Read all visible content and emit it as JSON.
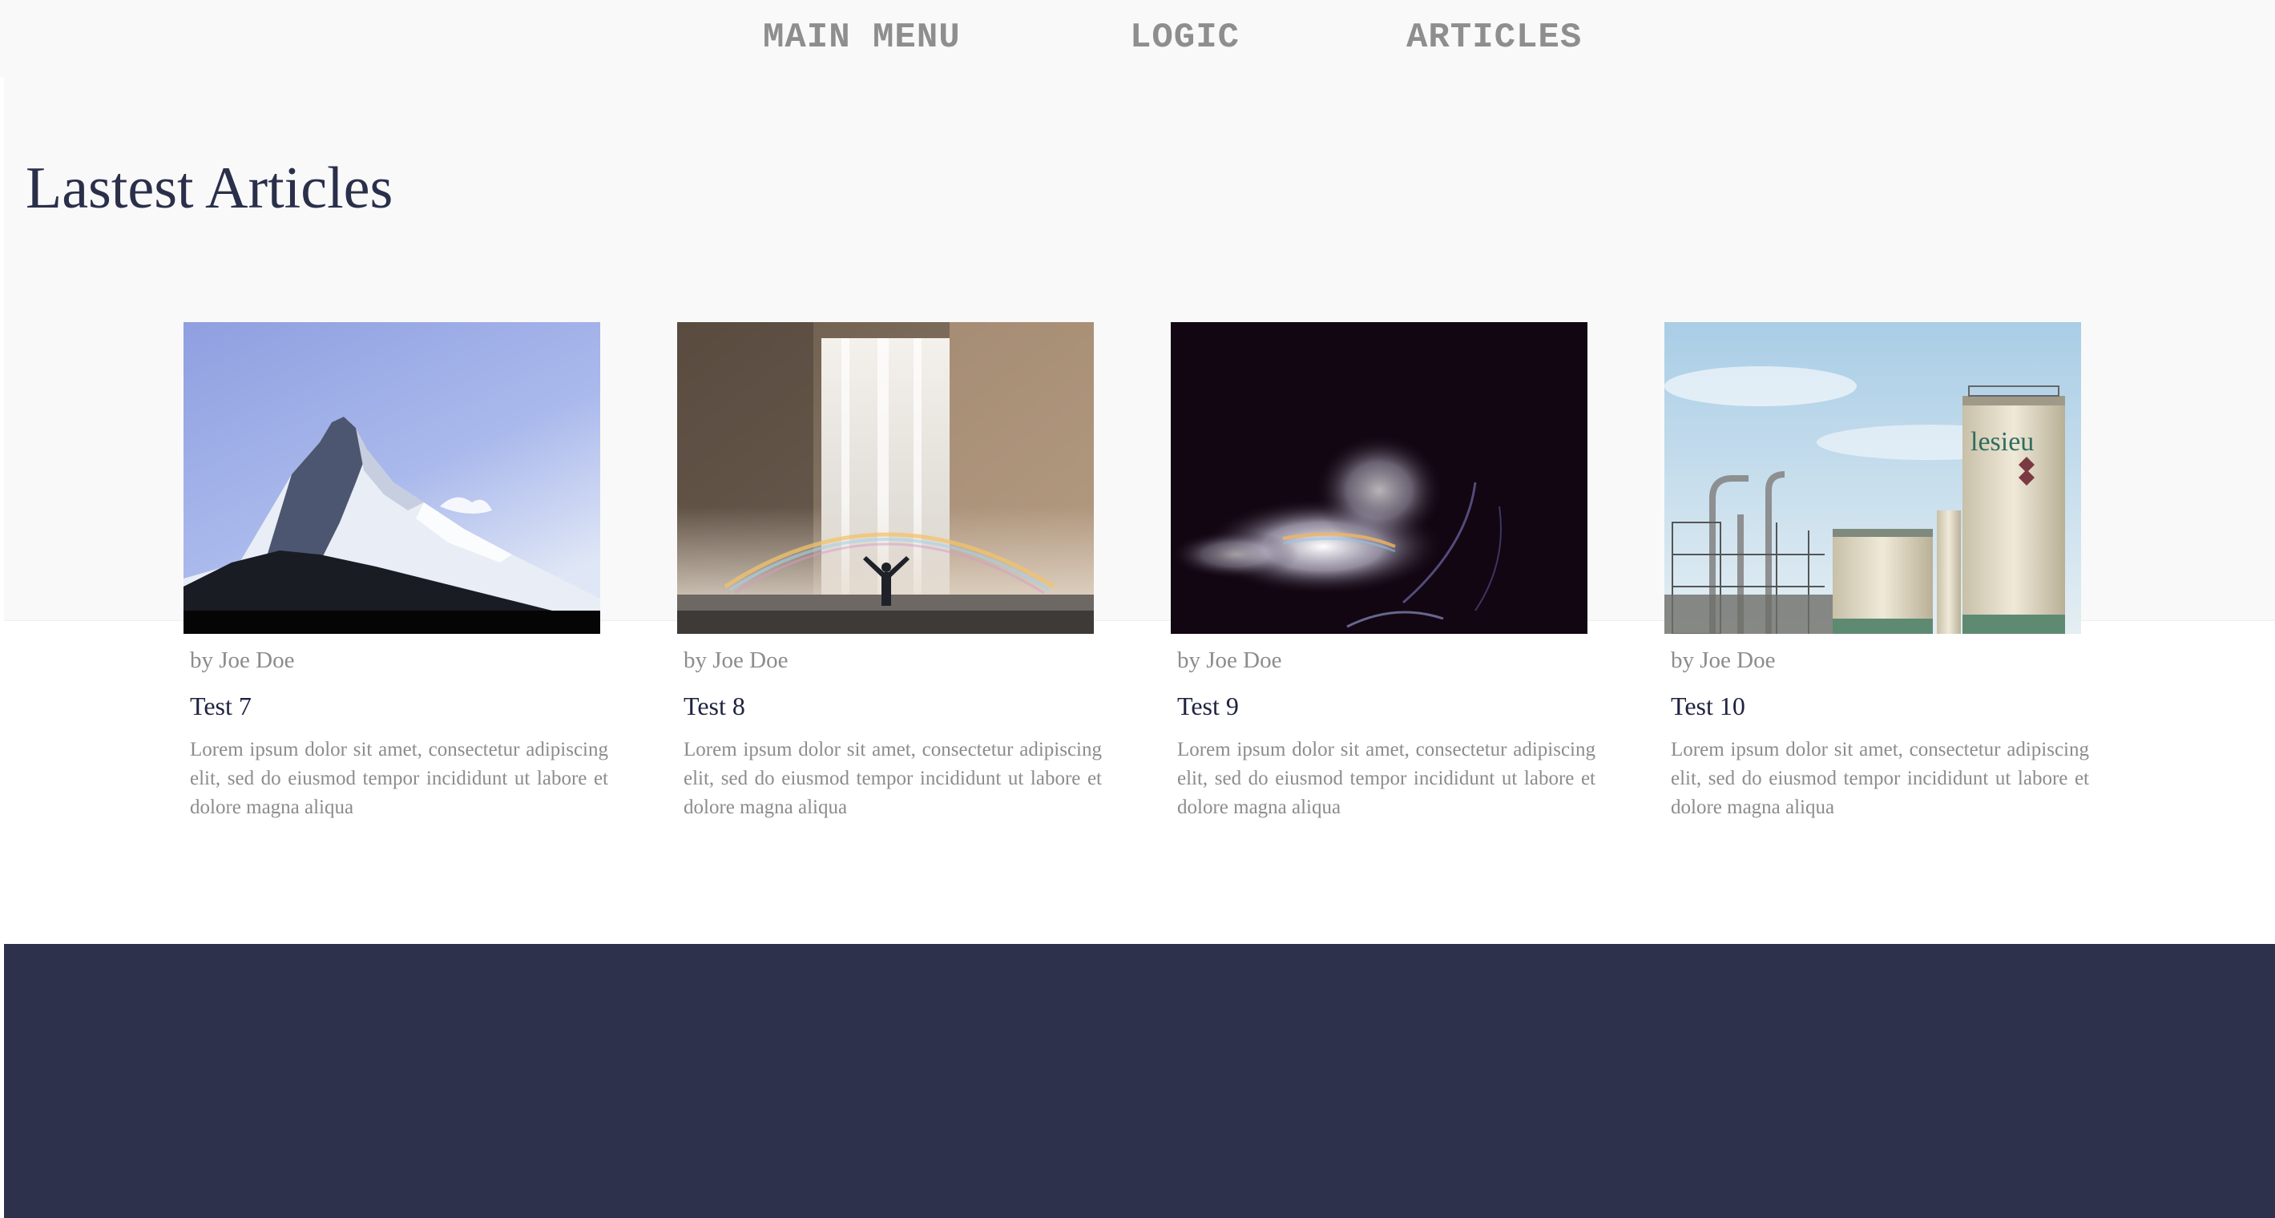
{
  "nav": {
    "items": [
      {
        "label": "MAIN MENU"
      },
      {
        "label": "LOGIC"
      },
      {
        "label": "ARTICLES"
      }
    ]
  },
  "hero": {
    "title": "Lastest Articles"
  },
  "articles": [
    {
      "image": "mountain-photo",
      "author": "by Joe Doe",
      "title": "Test 7",
      "excerpt": "Lorem ipsum dolor sit amet, consectetur adipiscing elit, sed do eiusmod tempor incididunt ut labore et dolore magna aliqua"
    },
    {
      "image": "waterfall-photo",
      "author": "by Joe Doe",
      "title": "Test 8",
      "excerpt": "Lorem ipsum dolor sit amet, consectetur adipiscing elit, sed do eiusmod tempor incididunt ut labore et dolore magna aliqua"
    },
    {
      "image": "smoke-silhouette-photo",
      "author": "by Joe Doe",
      "title": "Test 9",
      "excerpt": "Lorem ipsum dolor sit amet, consectetur adipiscing elit, sed do eiusmod tempor incididunt ut labore et dolore magna aliqua"
    },
    {
      "image": "industrial-plant-photo",
      "author": "by Joe Doe",
      "title": "Test 10",
      "excerpt": "Lorem ipsum dolor sit amet, consectetur adipiscing elit, sed do eiusmod tempor incididunt ut labore et dolore magna aliqua",
      "image_sign_text": "lesieu"
    }
  ],
  "colors": {
    "nav_background": "#f9f9f9",
    "nav_text": "#8e8e8e",
    "title_text": "#2a2f4a",
    "body_text": "#8c8c8c",
    "footer_background": "#2d314b"
  }
}
